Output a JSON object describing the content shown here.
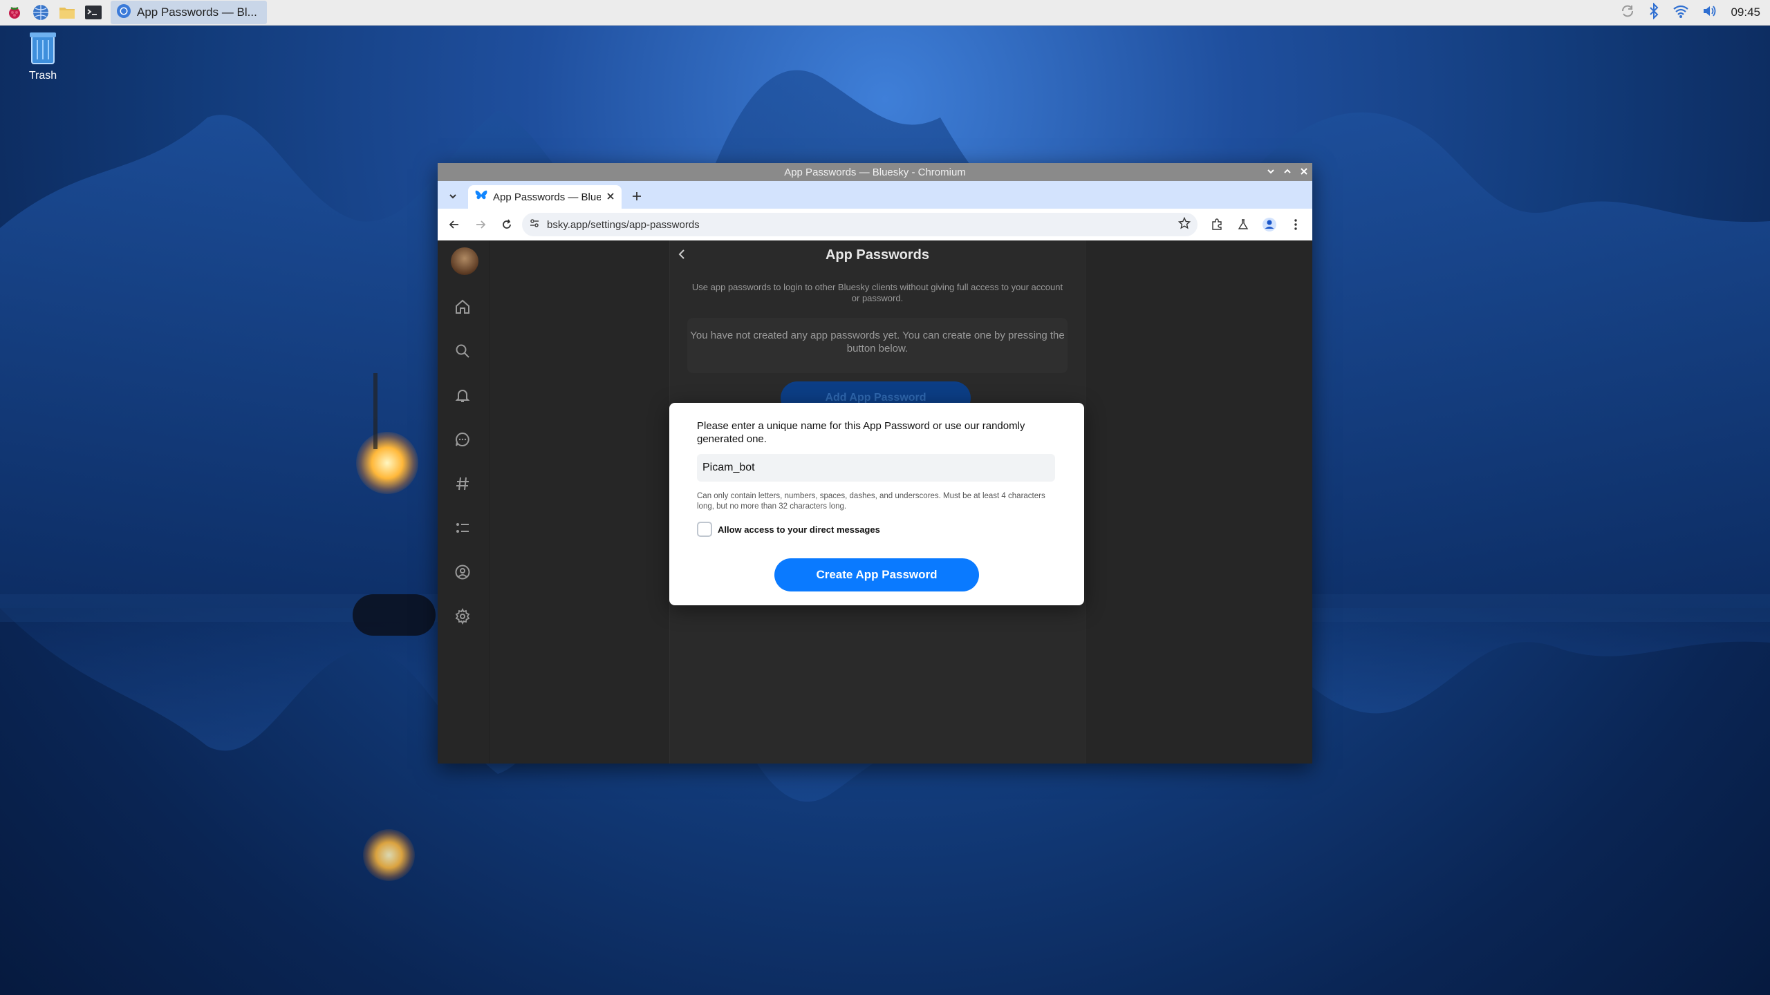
{
  "taskbar": {
    "task_label": "App Passwords — Bl...",
    "clock": "09:45"
  },
  "desktop": {
    "trash_label": "Trash"
  },
  "window": {
    "title": "App Passwords — Bluesky - Chromium",
    "tab_title": "App Passwords — Bluesky",
    "url": "bsky.app/settings/app-passwords"
  },
  "page": {
    "header": "App Passwords",
    "description": "Use app passwords to login to other Bluesky clients without giving full access to your account or password.",
    "empty_state": "You have not created any app passwords yet. You can create one by pressing the button below.",
    "add_button": "Add App Password"
  },
  "modal": {
    "prompt": "Please enter a unique name for this App Password or use our randomly generated one.",
    "name_value": "Picam_bot",
    "hint": "Can only contain letters, numbers, spaces, dashes, and underscores. Must be at least 4 characters long, but no more than 32 characters long.",
    "checkbox_label": "Allow access to your direct messages",
    "checkbox_checked": false,
    "create_button": "Create App Password"
  },
  "icons": {
    "sidebar": [
      "home-icon",
      "search-icon",
      "bell-icon",
      "chat-icon",
      "hashtag-icon",
      "list-icon",
      "profile-icon",
      "settings-icon"
    ]
  },
  "colors": {
    "accent": "#0a7aff",
    "tabstrip": "#d3e3fd",
    "titlebar": "#8a8a8a"
  }
}
